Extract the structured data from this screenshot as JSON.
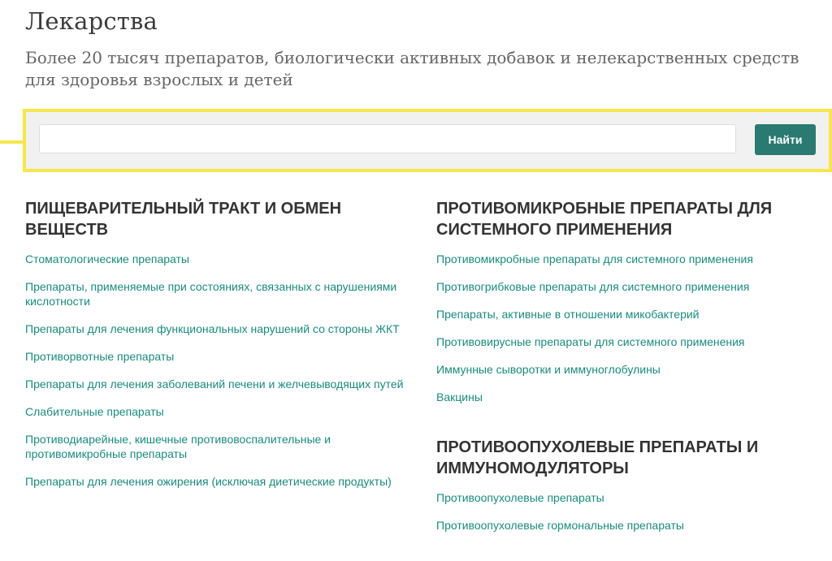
{
  "header": {
    "title": "Лекарства",
    "subtitle": "Более 20 тысяч препаратов, биологически активных добавок и нелекарственных средств для здоровья взрослых и детей"
  },
  "search": {
    "placeholder": "",
    "value": "",
    "button_label": "Найти"
  },
  "colors": {
    "accent_yellow": "#f7e64c",
    "button_teal": "#2a7a72",
    "link_teal": "#1a8a7e",
    "panel_gray": "#f1f1f1"
  },
  "categories": [
    {
      "title": "ПИЩЕВАРИТЕЛЬНЫЙ ТРАКТ И ОБМЕН ВЕЩЕСТВ",
      "items": [
        "Стоматологические препараты",
        "Препараты, применяемые при состояниях, связанных с нарушениями кислотности",
        "Препараты для лечения функциональных нарушений со стороны ЖКТ",
        "Противорвотные препараты",
        "Препараты для лечения заболеваний печени и желчевыводящих путей",
        "Слабительные препараты",
        "Противодиарейные, кишечные противовоспалительные и противомикробные препараты",
        "Препараты для лечения ожирения (исключая диетические продукты)"
      ]
    },
    {
      "title": "ПРОТИВОМИКРОБНЫЕ ПРЕПАРАТЫ ДЛЯ СИСТЕМНОГО ПРИМЕНЕНИЯ",
      "items": [
        "Противомикробные препараты для системного применения",
        "Противогрибковые препараты для системного применения",
        "Препараты, активные в отношении микобактерий",
        "Противовирусные препараты для системного применения",
        "Иммунные сыворотки и иммуноглобулины",
        "Вакцины"
      ]
    },
    {
      "title": "ПРОТИВООПУХОЛЕВЫЕ ПРЕПАРАТЫ И ИММУНОМОДУЛЯТОРЫ",
      "items": [
        "Противоопухолевые препараты",
        "Противоопухолевые гормональные препараты"
      ]
    }
  ]
}
